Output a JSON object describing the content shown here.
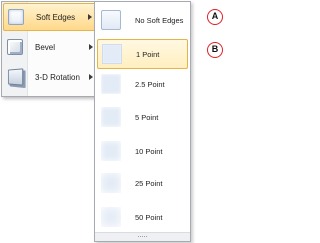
{
  "effects_menu": {
    "items": [
      {
        "label": "Soft Edges",
        "icon": "soft-edges-icon",
        "active": true
      },
      {
        "label": "Bevel",
        "icon": "bevel-icon",
        "active": false
      },
      {
        "label": "3-D Rotation",
        "icon": "3d-rotation-icon",
        "active": false
      }
    ]
  },
  "soft_edges_gallery": {
    "items": [
      {
        "label": "No Soft Edges",
        "selected": false
      },
      {
        "label": "1 Point",
        "selected": true
      },
      {
        "label": "2.5 Point",
        "selected": false
      },
      {
        "label": "5 Point",
        "selected": false
      },
      {
        "label": "10 Point",
        "selected": false
      },
      {
        "label": "25 Point",
        "selected": false
      },
      {
        "label": "50 Point",
        "selected": false
      }
    ],
    "more_indicator": "....."
  },
  "callouts": {
    "a": "A",
    "b": "B"
  },
  "colors": {
    "highlight_fill": "#ffd98a",
    "highlight_border": "#e3b44a",
    "callout_ring": "#e41e26",
    "thumb_fill": "#e3ebf6"
  }
}
